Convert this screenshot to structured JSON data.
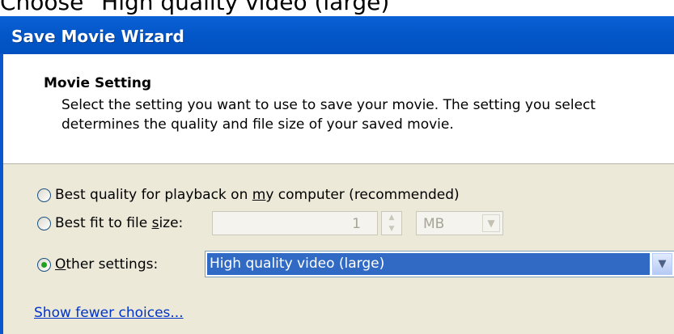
{
  "caption": "Choose \"High quality video (large)\"",
  "window": {
    "title": "Save Movie Wizard"
  },
  "header": {
    "title": "Movie Setting",
    "description": "Select the setting you want to use to save your movie. The setting you select determines the quality and file size of your saved movie."
  },
  "options": {
    "best_quality": {
      "label_before": "Best quality for playback on ",
      "label_underlined": "m",
      "label_after": "y computer (recommended)",
      "selected": false
    },
    "best_fit": {
      "label_before": "Best fit to file ",
      "label_underlined": "s",
      "label_after": "ize:",
      "selected": false,
      "size_value": "1",
      "unit_value": "MB"
    },
    "other": {
      "label_before": "",
      "label_underlined": "O",
      "label_after": "ther settings:",
      "selected": true,
      "selected_value": "High quality video (large)"
    }
  },
  "link": {
    "show_fewer": "Show fewer choices..."
  },
  "colors": {
    "titlebar": "#0457c9",
    "body_bg": "#ece9d8",
    "selection": "#316ac5",
    "radio_dot": "#21a121",
    "link": "#0033cc"
  },
  "icons": {
    "spin_up": "triangle-up",
    "spin_down": "triangle-down",
    "dropdown": "chevron-down"
  }
}
